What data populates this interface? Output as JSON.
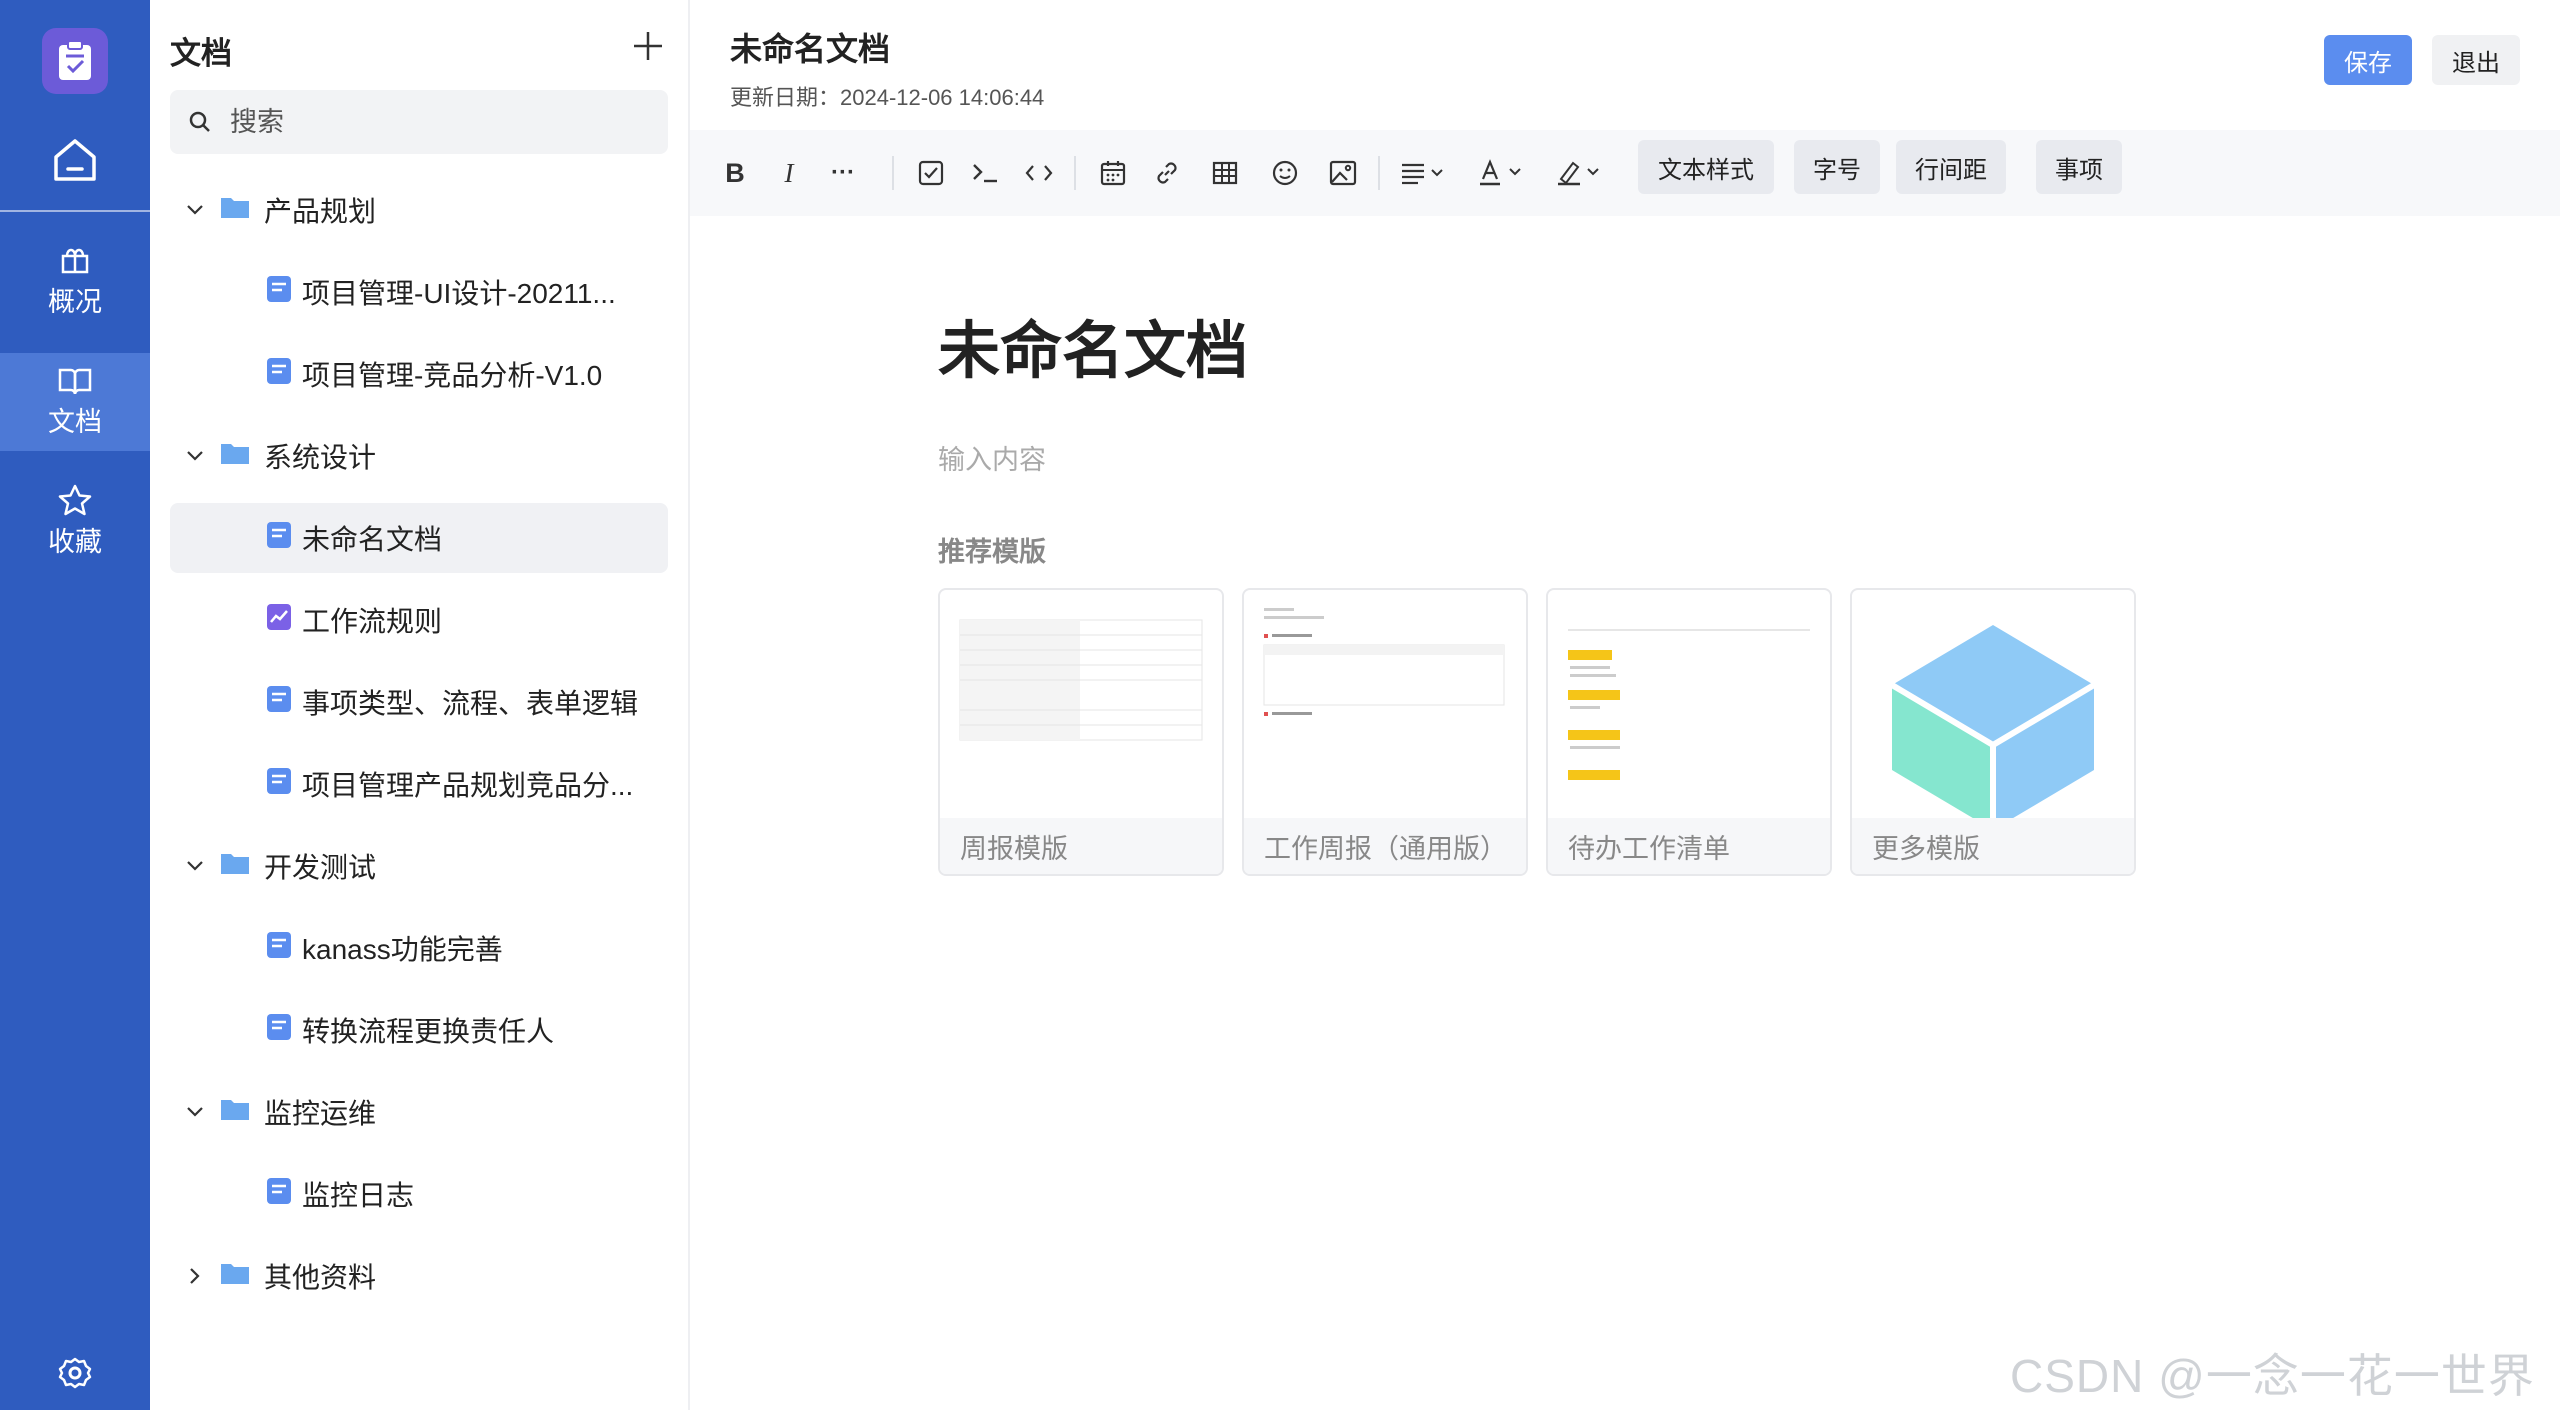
{
  "rail": {
    "items": [
      {
        "label": "概况",
        "icon": "package-icon"
      },
      {
        "label": "文档",
        "icon": "book-icon"
      },
      {
        "label": "收藏",
        "icon": "star-icon"
      }
    ]
  },
  "tree": {
    "title": "文档",
    "search_placeholder": "搜索",
    "folders": [
      {
        "label": "产品规划",
        "expanded": true
      },
      {
        "label": "系统设计",
        "expanded": true
      },
      {
        "label": "开发测试",
        "expanded": true
      },
      {
        "label": "监控运维",
        "expanded": true
      },
      {
        "label": "其他资料",
        "expanded": false
      }
    ],
    "docs": [
      {
        "label": "项目管理-UI设计-20211...",
        "type": "doc"
      },
      {
        "label": "项目管理-竞品分析-V1.0",
        "type": "doc"
      },
      {
        "label": "未命名文档",
        "type": "doc",
        "selected": true
      },
      {
        "label": "工作流规则",
        "type": "chart"
      },
      {
        "label": "事项类型、流程、表单逻辑",
        "type": "doc"
      },
      {
        "label": "项目管理产品规划竞品分...",
        "type": "doc"
      },
      {
        "label": "kanass功能完善",
        "type": "doc"
      },
      {
        "label": "转换流程更换责任人",
        "type": "doc"
      },
      {
        "label": "监控日志",
        "type": "doc"
      }
    ]
  },
  "header": {
    "title": "未命名文档",
    "date": "更新日期：2024-12-06 14:06:44",
    "save": "保存",
    "exit": "退出"
  },
  "toolbar": {
    "bold": "B",
    "italic": "I",
    "more": "···",
    "pills": [
      "文本样式",
      "字号",
      "行间距",
      "事项"
    ]
  },
  "editor": {
    "title": "未命名文档",
    "placeholder": "输入内容",
    "recommend_title": "推荐模版",
    "templates": [
      "周报模版",
      "工作周报（通用版）",
      "待办工作清单",
      "更多模版"
    ]
  },
  "colors": {
    "rail": "#2f5cbf",
    "rail_active": "#4d79d6",
    "primary": "#5b8def",
    "folder": "#6aa8ef"
  },
  "watermark": "CSDN @一念一花一世界"
}
